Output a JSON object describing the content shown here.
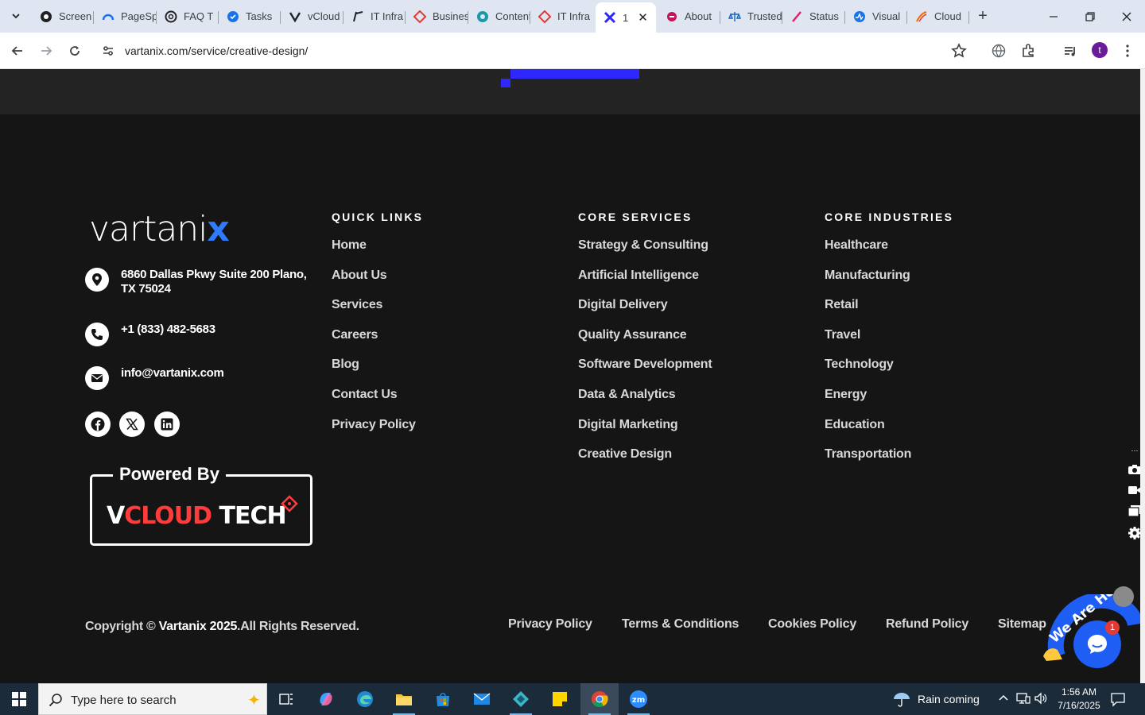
{
  "browser": {
    "tabs": [
      {
        "title": "Screen",
        "icon": "screencast-icon"
      },
      {
        "title": "PageSpeed",
        "icon": "pagespeed-icon"
      },
      {
        "title": "FAQ T",
        "icon": "openai-icon"
      },
      {
        "title": "Tasks",
        "icon": "tasks-icon"
      },
      {
        "title": "vCloud",
        "icon": "vcloud-icon"
      },
      {
        "title": "IT Infra",
        "icon": "itinfra-icon"
      },
      {
        "title": "Business",
        "icon": "business-icon"
      },
      {
        "title": "Content",
        "icon": "content-icon"
      },
      {
        "title": "IT Infra",
        "icon": "itinfra-red-icon"
      },
      {
        "title": "1",
        "icon": "vartanix-icon",
        "active": true
      },
      {
        "title": "About",
        "icon": "about-icon"
      },
      {
        "title": "Trusted",
        "icon": "scale-icon"
      },
      {
        "title": "Status",
        "icon": "status-icon"
      },
      {
        "title": "Visual",
        "icon": "visual-icon"
      },
      {
        "title": "Cloud",
        "icon": "cloud-icon"
      }
    ],
    "url": "vartanix.com/service/creative-design/",
    "profile_initial": "t"
  },
  "footer": {
    "contact": {
      "address": "6860 Dallas Pkwy Suite 200 Plano, TX 75024",
      "phone": "+1 (833) 482-5683",
      "email": "info@vartanix.com"
    },
    "powered_by": {
      "label": "Powered By",
      "brand_v": "V",
      "brand_red": "CLOUD",
      "brand_rest": " TECH"
    },
    "quick_links": {
      "heading": "QUICK LINKS",
      "items": [
        "Home",
        "About Us",
        "Services",
        "Careers",
        "Blog",
        "Contact Us",
        "Privacy Policy"
      ]
    },
    "core_services": {
      "heading": "CORE SERVICES",
      "items": [
        "Strategy & Consulting",
        "Artificial Intelligence",
        "Digital Delivery",
        "Quality Assurance",
        "Software Development",
        "Data & Analytics",
        "Digital Marketing",
        "Creative Design"
      ]
    },
    "core_industries": {
      "heading": "CORE INDUSTRIES",
      "items": [
        "Healthcare",
        "Manufacturing",
        "Retail",
        "Travel",
        "Technology",
        "Energy",
        "Education",
        "Transportation"
      ]
    },
    "copyright_prefix": "Copyright © ",
    "copyright_brand": "Vartanix 2025",
    "copyright_suffix": ".All Rights Reserved.",
    "bottom_links": [
      "Privacy Policy",
      "Terms & Conditions",
      "Cookies Policy",
      "Refund Policy",
      "Sitemap"
    ]
  },
  "chat_widget": {
    "badge_count": "1"
  },
  "taskbar": {
    "search_placeholder": "Type here to search",
    "weather": "Rain coming",
    "time": "1:56 AM",
    "date": "7/16/2025"
  },
  "colors": {
    "accent_blue": "#2e27ff",
    "background": "#151515",
    "chat_blue": "#1e5ef5"
  }
}
